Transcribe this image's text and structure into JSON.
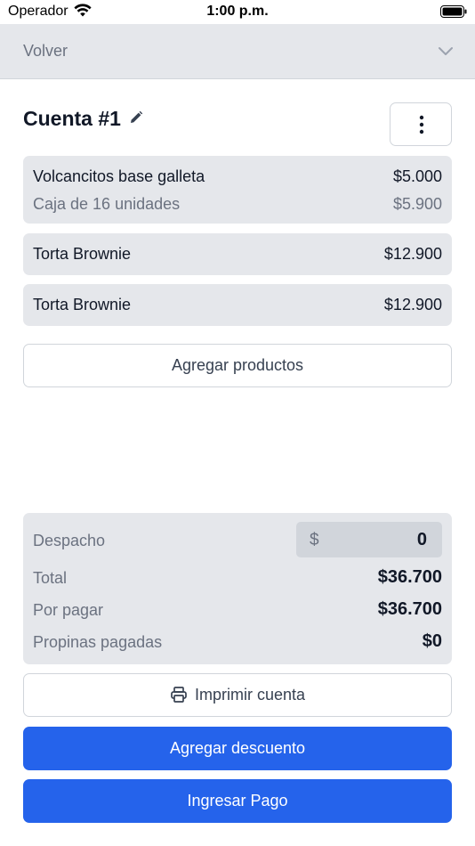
{
  "status_bar": {
    "carrier": "Operador",
    "time": "1:00 p.m."
  },
  "header": {
    "back_label": "Volver"
  },
  "account": {
    "title": "Cuenta #1"
  },
  "products": [
    {
      "name": "Volcancitos base galleta",
      "price": "$5.000",
      "variant": "Caja de 16 unidades",
      "variant_price": "$5.900"
    },
    {
      "name": "Torta Brownie",
      "price": "$12.900"
    },
    {
      "name": "Torta Brownie",
      "price": "$12.900"
    }
  ],
  "add_products_label": "Agregar productos",
  "summary": {
    "despacho_label": "Despacho",
    "despacho_currency": "$",
    "despacho_value": "0",
    "total_label": "Total",
    "total_value": "$36.700",
    "pending_label": "Por pagar",
    "pending_value": "$36.700",
    "tips_label": "Propinas pagadas",
    "tips_value": "$0"
  },
  "actions": {
    "print_label": "Imprimir cuenta",
    "discount_label": "Agregar descuento",
    "payment_label": "Ingresar Pago"
  },
  "colors": {
    "primary": "#2563eb",
    "card_bg": "#e5e7eb"
  }
}
